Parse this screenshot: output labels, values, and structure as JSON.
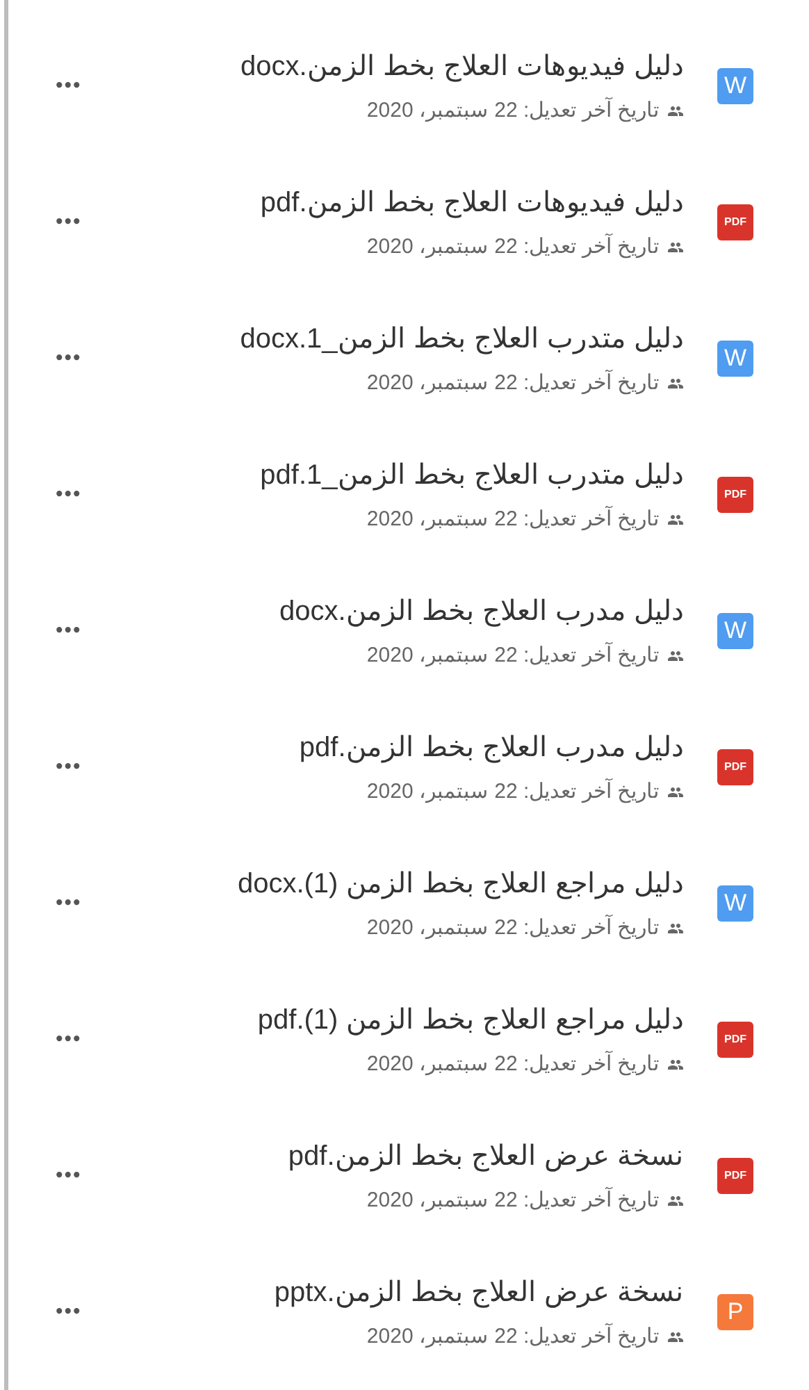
{
  "files": [
    {
      "name": "دليل فيديوهات العلاج بخط الزمن.docx",
      "kind": "word",
      "icon_label": "W",
      "modified": "تاريخ آخر تعديل: 22 سبتمبر، 2020",
      "more": "•••"
    },
    {
      "name": "دليل فيديوهات العلاج بخط الزمن.pdf",
      "kind": "pdf",
      "icon_label": "PDF",
      "modified": "تاريخ آخر تعديل: 22 سبتمبر، 2020",
      "more": "•••"
    },
    {
      "name": "دليل متدرب العلاج بخط الزمن_1.docx",
      "kind": "word",
      "icon_label": "W",
      "modified": "تاريخ آخر تعديل: 22 سبتمبر، 2020",
      "more": "•••"
    },
    {
      "name": "دليل متدرب العلاج بخط الزمن_1.pdf",
      "kind": "pdf",
      "icon_label": "PDF",
      "modified": "تاريخ آخر تعديل: 22 سبتمبر، 2020",
      "more": "•••"
    },
    {
      "name": "دليل مدرب العلاج بخط الزمن.docx",
      "kind": "word",
      "icon_label": "W",
      "modified": "تاريخ آخر تعديل: 22 سبتمبر، 2020",
      "more": "•••"
    },
    {
      "name": "دليل مدرب العلاج بخط الزمن.pdf",
      "kind": "pdf",
      "icon_label": "PDF",
      "modified": "تاريخ آخر تعديل: 22 سبتمبر، 2020",
      "more": "•••"
    },
    {
      "name": "دليل مراجع العلاج بخط الزمن (1).docx",
      "kind": "word",
      "icon_label": "W",
      "modified": "تاريخ آخر تعديل: 22 سبتمبر، 2020",
      "more": "•••"
    },
    {
      "name": "دليل مراجع العلاج بخط الزمن (1).pdf",
      "kind": "pdf",
      "icon_label": "PDF",
      "modified": "تاريخ آخر تعديل: 22 سبتمبر، 2020",
      "more": "•••"
    },
    {
      "name": "نسخة عرض العلاج بخط الزمن.pdf",
      "kind": "pdf",
      "icon_label": "PDF",
      "modified": "تاريخ آخر تعديل: 22 سبتمبر، 2020",
      "more": "•••"
    },
    {
      "name": "نسخة عرض العلاج بخط الزمن.pptx",
      "kind": "ppt",
      "icon_label": "P",
      "modified": "تاريخ آخر تعديل: 22 سبتمبر، 2020",
      "more": "•••"
    }
  ]
}
